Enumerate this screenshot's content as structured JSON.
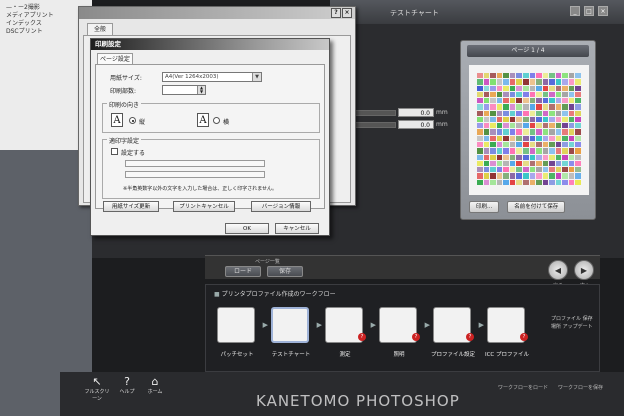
{
  "bg_menu": {
    "items": [
      "—・ー2撮影",
      "メディアプリント",
      "インデックス",
      "DSCプリント"
    ]
  },
  "app": {
    "title": "テストチャート",
    "ctrls": [
      "_",
      "□",
      "×"
    ]
  },
  "fields": {
    "width_value": "0.0",
    "height_value": "0.0",
    "unit": "mm"
  },
  "preview": {
    "page_label": "ページ 1 / 4",
    "print_button": "印刷...",
    "save_button": "名前を付けて保存"
  },
  "page_strip": {
    "label": "ページ一覧",
    "load_button": "ロード",
    "save_button": "保存"
  },
  "nav": {
    "back_label": "戻る",
    "next_label": "次へ"
  },
  "workflow": {
    "title": "プリンタプロファイル作成のワークフロー",
    "steps": [
      {
        "label": "パッチセット",
        "badge": ""
      },
      {
        "label": "テストチャート",
        "badge": ""
      },
      {
        "label": "測定",
        "badge": "?"
      },
      {
        "label": "照明",
        "badge": "?"
      },
      {
        "label": "プロファイル設定",
        "badge": "?"
      },
      {
        "label": "ICC プロファイル",
        "badge": "?"
      }
    ],
    "side_text": "プロファイル 保存場所 アップデート"
  },
  "bottom": {
    "items": [
      {
        "label": "フルスクリーン",
        "icon": "↖"
      },
      {
        "label": "ヘルプ",
        "icon": "?"
      },
      {
        "label": "ホーム",
        "icon": "⌂"
      }
    ],
    "right_label_1": "ワークフローをロード",
    "right_label_2": "ワークフローを保存"
  },
  "watermark": "KANETOMO PHOTOSHOP",
  "back_dialog": {
    "tab": "全般",
    "ctrls": [
      "?",
      "×"
    ]
  },
  "dialog": {
    "title": "印刷設定",
    "tab": "ページ設定",
    "paper_size_label": "用紙サイズ:",
    "paper_size_value": "A4(Ver 1264x2003)",
    "copies_label": "印刷部数:",
    "copies_value": "1",
    "orientation_label": "印刷の向き",
    "portrait_label": "縦",
    "landscape_label": "横",
    "orient_icon_glyph": "A",
    "footer_label": "適印字設定",
    "footer_checkbox_label": "設定する",
    "note": "※半角英数字以外の文字を入力した場合は、正しく印字されません。",
    "btn_update": "用紙サイズ更新",
    "btn_cancel_print": "プリントキャンセル",
    "btn_version": "バージョン情報",
    "btn_ok": "OK",
    "btn_cancel": "キャンセル"
  },
  "colors": {
    "swatches": [
      "#e23a3a",
      "#2fa84a",
      "#3a54d6",
      "#d8c92a",
      "#c43ab8",
      "#2ec4c4",
      "#8c2a2a",
      "#7adf6a",
      "#6a6ae8",
      "#e89a3a",
      "#a0a0a0",
      "#ff6ab0",
      "#4a8c3a",
      "#3a9ae8",
      "#e8e84a",
      "#6a3a8c"
    ]
  }
}
